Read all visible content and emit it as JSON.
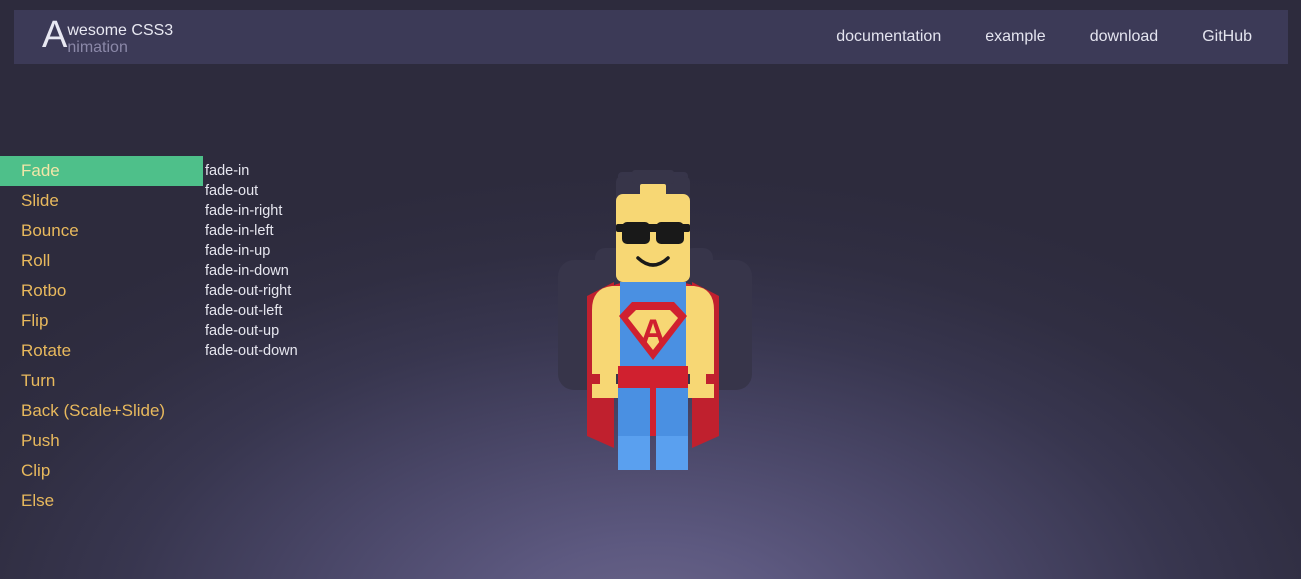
{
  "header": {
    "logo": {
      "initial": "A",
      "line1": "wesome CSS3",
      "line2": "nimation"
    },
    "nav": [
      {
        "label": "documentation",
        "name": "nav-documentation"
      },
      {
        "label": "example",
        "name": "nav-example"
      },
      {
        "label": "download",
        "name": "nav-download"
      },
      {
        "label": "GitHub",
        "name": "nav-github"
      }
    ]
  },
  "sidebar": {
    "active_index": 0,
    "items": [
      {
        "label": "Fade"
      },
      {
        "label": "Slide"
      },
      {
        "label": "Bounce"
      },
      {
        "label": "Roll"
      },
      {
        "label": "Rotbo"
      },
      {
        "label": "Flip"
      },
      {
        "label": "Rotate"
      },
      {
        "label": "Turn"
      },
      {
        "label": "Back (Scale+Slide)"
      },
      {
        "label": "Push"
      },
      {
        "label": "Clip"
      },
      {
        "label": "Else"
      }
    ]
  },
  "animations": [
    {
      "label": "fade-in"
    },
    {
      "label": "fade-out"
    },
    {
      "label": "fade-in-right"
    },
    {
      "label": "fade-in-left"
    },
    {
      "label": "fade-in-up"
    },
    {
      "label": "fade-in-down"
    },
    {
      "label": "fade-out-right"
    },
    {
      "label": "fade-out-left"
    },
    {
      "label": "fade-out-up"
    },
    {
      "label": "fade-out-down"
    }
  ],
  "preview": {
    "figure_name": "lego-superhero-figure",
    "emblem_letter": "A",
    "colors": {
      "page_background": "#2f2e41",
      "header_background": "#3c3a57",
      "menu_text": "#e8b95d",
      "menu_active_background": "#4ec08a",
      "menu_active_text": "#f2e6a8",
      "animation_text": "#e6e6ef",
      "skin": "#f7d774",
      "suit_blue": "#4a90e2",
      "cape_red": "#d0202f",
      "hair_dark": "#373549",
      "glasses_black": "#191919",
      "leg_light": "#5aa0ef"
    }
  }
}
